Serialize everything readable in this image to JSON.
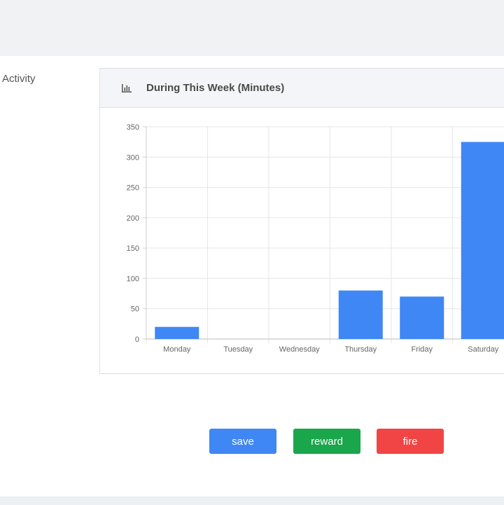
{
  "section": {
    "label": "Activity"
  },
  "card": {
    "title": "During This Week (Minutes)",
    "icon": "bar-chart-icon"
  },
  "buttons": {
    "save": "save",
    "reward": "reward",
    "fire": "fire"
  },
  "colors": {
    "bar": "#3f87f5",
    "save": "#3f87f5",
    "reward": "#1aa64a",
    "fire": "#f14545"
  },
  "chart_data": {
    "type": "bar",
    "title": "During This Week (Minutes)",
    "xlabel": "",
    "ylabel": "",
    "categories": [
      "Monday",
      "Tuesday",
      "Wednesday",
      "Thursday",
      "Friday",
      "Saturday"
    ],
    "values": [
      20,
      0,
      0,
      80,
      70,
      325
    ],
    "ylim": [
      0,
      350
    ],
    "yticks": [
      "0",
      "50",
      "100",
      "150",
      "200",
      "250",
      "300",
      "350"
    ],
    "grid": true,
    "legend": "none"
  }
}
